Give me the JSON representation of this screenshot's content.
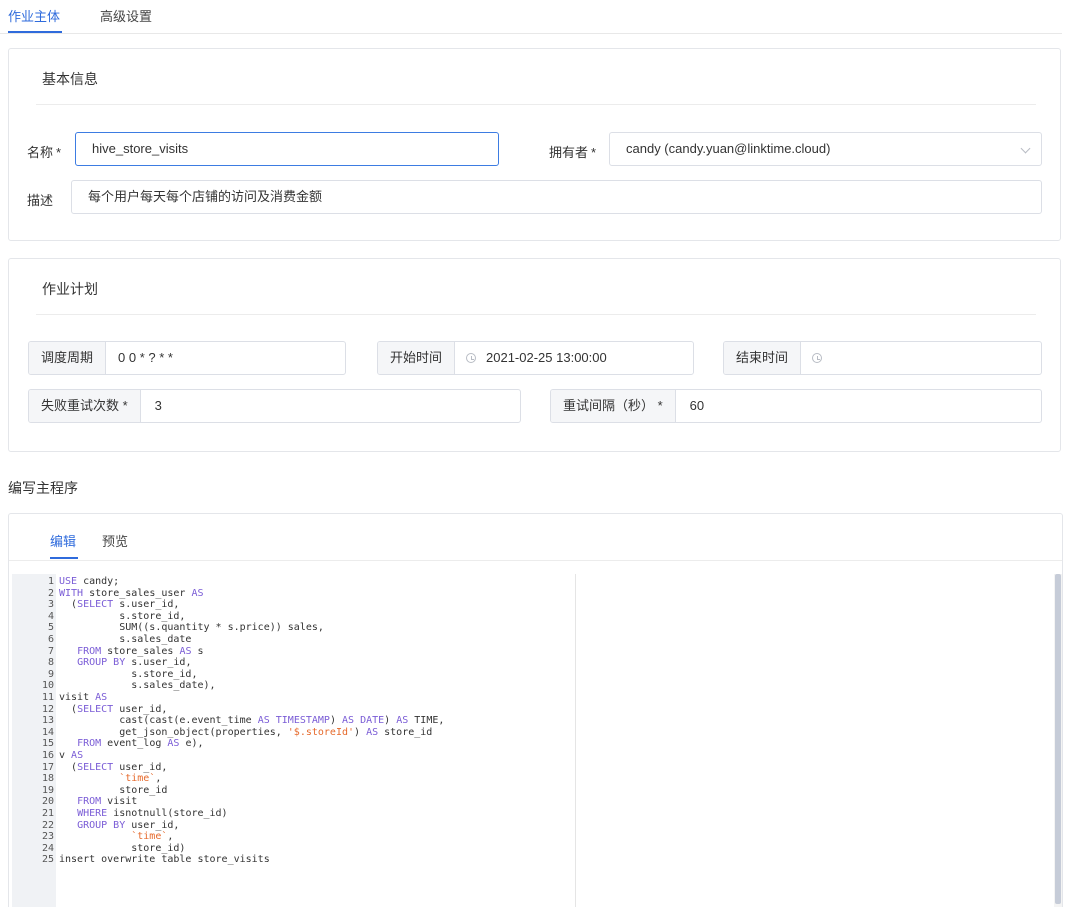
{
  "tabs": [
    "作业主体",
    "高级设置"
  ],
  "basic": {
    "title": "基本信息",
    "name_label": "名称",
    "name_value": "hive_store_visits",
    "owner_label": "拥有者",
    "owner_value": "candy (candy.yuan@linktime.cloud)",
    "desc_label": "描述",
    "desc_value": "每个用户每天每个店铺的访问及消费金额",
    "required_mark": "*"
  },
  "plan": {
    "title": "作业计划",
    "cycle_label": "调度周期",
    "cycle_value": "0 0 * ? * *",
    "start_label": "开始时间",
    "start_value": "2021-02-25 13:00:00",
    "end_label": "结束时间",
    "end_value": "",
    "retry_label": "失败重试次数 *",
    "retry_value": "3",
    "interval_label": "重试间隔（秒） *",
    "interval_value": "60"
  },
  "program": {
    "title": "编写主程序",
    "tabs": [
      "编辑",
      "预览"
    ]
  },
  "code": {
    "lines": [
      [
        [
          "k",
          "USE"
        ],
        [
          "t",
          " candy;"
        ]
      ],
      [
        [
          "k",
          "WITH"
        ],
        [
          "t",
          " store_sales_user "
        ],
        [
          "k",
          "AS"
        ]
      ],
      [
        [
          "t",
          "  ("
        ],
        [
          "k",
          "SELECT"
        ],
        [
          "t",
          " s.user_id,"
        ]
      ],
      [
        [
          "t",
          "          s.store_id,"
        ]
      ],
      [
        [
          "t",
          "          SUM((s.quantity * s.price)) sales,"
        ]
      ],
      [
        [
          "t",
          "          s.sales_date"
        ]
      ],
      [
        [
          "t",
          "   "
        ],
        [
          "k",
          "FROM"
        ],
        [
          "t",
          " store_sales "
        ],
        [
          "k",
          "AS"
        ],
        [
          "t",
          " s"
        ]
      ],
      [
        [
          "t",
          "   "
        ],
        [
          "k",
          "GROUP BY"
        ],
        [
          "t",
          " s.user_id,"
        ]
      ],
      [
        [
          "t",
          "            s.store_id,"
        ]
      ],
      [
        [
          "t",
          "            s.sales_date),"
        ]
      ],
      [
        [
          "t",
          "visit "
        ],
        [
          "k",
          "AS"
        ]
      ],
      [
        [
          "t",
          "  ("
        ],
        [
          "k",
          "SELECT"
        ],
        [
          "t",
          " user_id,"
        ]
      ],
      [
        [
          "t",
          "          cast(cast(e.event_time "
        ],
        [
          "k",
          "AS"
        ],
        [
          "t",
          " "
        ],
        [
          "k",
          "TIMESTAMP"
        ],
        [
          "t",
          ") "
        ],
        [
          "k",
          "AS"
        ],
        [
          "t",
          " "
        ],
        [
          "k",
          "DATE"
        ],
        [
          "t",
          ") "
        ],
        [
          "k",
          "AS"
        ],
        [
          "t",
          " TIME,"
        ]
      ],
      [
        [
          "t",
          "          get_json_object(properties, "
        ],
        [
          "s",
          "'$.storeId'"
        ],
        [
          "t",
          ") "
        ],
        [
          "k",
          "AS"
        ],
        [
          "t",
          " store_id"
        ]
      ],
      [
        [
          "t",
          "   "
        ],
        [
          "k",
          "FROM"
        ],
        [
          "t",
          " event_log "
        ],
        [
          "k",
          "AS"
        ],
        [
          "t",
          " e),"
        ]
      ],
      [
        [
          "t",
          "v "
        ],
        [
          "k",
          "AS"
        ]
      ],
      [
        [
          "t",
          "  ("
        ],
        [
          "k",
          "SELECT"
        ],
        [
          "t",
          " user_id,"
        ]
      ],
      [
        [
          "t",
          "          "
        ],
        [
          "s",
          "`time`"
        ],
        [
          "t",
          ","
        ]
      ],
      [
        [
          "t",
          "          store_id"
        ]
      ],
      [
        [
          "t",
          "   "
        ],
        [
          "k",
          "FROM"
        ],
        [
          "t",
          " visit"
        ]
      ],
      [
        [
          "t",
          "   "
        ],
        [
          "k",
          "WHERE"
        ],
        [
          "t",
          " isnotnull(store_id)"
        ]
      ],
      [
        [
          "t",
          "   "
        ],
        [
          "k",
          "GROUP BY"
        ],
        [
          "t",
          " user_id,"
        ]
      ],
      [
        [
          "t",
          "            "
        ],
        [
          "s",
          "`time`"
        ],
        [
          "t",
          ","
        ]
      ],
      [
        [
          "t",
          "            store_id)"
        ]
      ],
      [
        [
          "t",
          "insert overwrite table store_visits"
        ]
      ]
    ]
  },
  "colors": {
    "accent": "#2f6bdc",
    "keyword": "#7a5cd6",
    "string": "#e66a2c",
    "focus_border": "#3d7ce2"
  }
}
